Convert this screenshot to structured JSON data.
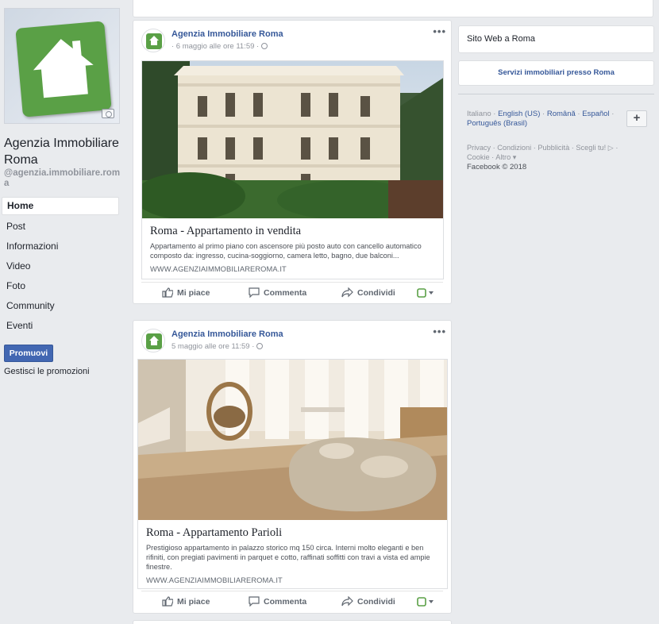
{
  "page": {
    "name": "Agenzia Immobiliare Roma",
    "handle": "@agenzia.immobiliare.roma"
  },
  "nav": {
    "items": [
      {
        "label": "Home"
      },
      {
        "label": "Post"
      },
      {
        "label": "Informazioni"
      },
      {
        "label": "Video"
      },
      {
        "label": "Foto"
      },
      {
        "label": "Community"
      },
      {
        "label": "Eventi"
      }
    ],
    "active": "Home",
    "promote_label": "Promuovi",
    "manage_promotions_label": "Gestisci le promozioni"
  },
  "posts": [
    {
      "author": "Agenzia Immobiliare Roma",
      "time": "· 6 maggio alle ore 11:59 ·",
      "link_title": "Roma - Appartamento in vendita",
      "link_desc": "Appartamento al primo piano con ascensore più posto auto con cancello automatico composto da: ingresso, cucina-soggiorno, camera letto, bagno, due balconi...",
      "link_url": "WWW.AGENZIAIMMOBILIAREROMA.IT"
    },
    {
      "author": "Agenzia Immobiliare Roma",
      "time": "5 maggio alle ore 11:59 ·",
      "link_title": "Roma - Appartamento Parioli",
      "link_desc": "Prestigioso appartamento in palazzo storico mq 150 circa. Interni molto eleganti e ben rifiniti, con pregiati pavimenti in parquet e cotto, raffinati soffitti con travi a vista ed ampie finestre.",
      "link_url": "WWW.AGENZIAIMMOBILIAREROMA.IT"
    }
  ],
  "actions": {
    "like": "Mi piace",
    "comment": "Commenta",
    "share": "Condividi"
  },
  "sidebar": {
    "website": "Sito Web a Roma",
    "services": "Servizi immobiliari presso Roma",
    "languages": [
      "Italiano",
      "English (US)",
      "Română",
      "Español",
      "Português (Brasil)"
    ],
    "footer_links": [
      "Privacy",
      "Condizioni",
      "Pubblicità",
      "Scegli tu!",
      "Cookie",
      "Altro"
    ],
    "copyright": "Facebook © 2018"
  },
  "colors": {
    "brand_green": "#5aa046",
    "link_blue": "#365899",
    "button_blue": "#4267b2",
    "background": "#e9ebee"
  }
}
